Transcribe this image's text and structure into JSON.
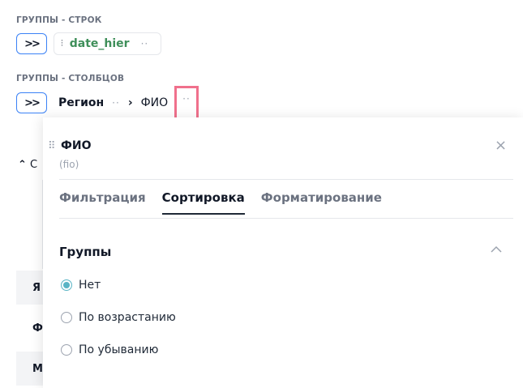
{
  "row_groups": {
    "label": "ГРУППЫ - СТРОК",
    "expand_label": ">>",
    "chip": {
      "hier_icon": "hierarchy-icon",
      "name": "date_hier",
      "dots": "··"
    }
  },
  "col_groups": {
    "label": "ГРУППЫ - СТОЛБЦОВ",
    "expand_label": ">>",
    "region": "Регион",
    "region_dots": "··",
    "separator": "›",
    "fio": "ФИО",
    "fio_dots": "··"
  },
  "background": {
    "collapse_chevron": "^",
    "collapse_letter": "С",
    "rows": [
      "Я",
      "Ф",
      "М"
    ]
  },
  "panel": {
    "drag_icon": "⠿",
    "title": "ФИО",
    "subtitle": "(fio)",
    "close": "×",
    "tabs": [
      {
        "label": "Фильтрация",
        "active": false
      },
      {
        "label": "Сортировка",
        "active": true
      },
      {
        "label": "Форматирование",
        "active": false
      }
    ],
    "group_title": "Группы",
    "group_chevron": "^",
    "options": [
      {
        "label": "Нет",
        "checked": true
      },
      {
        "label": "По возрастанию",
        "checked": false
      },
      {
        "label": "По убыванию",
        "checked": false
      }
    ]
  },
  "colors": {
    "accent": "#3b82f6",
    "highlight": "#f0708c",
    "radio": "#5ab4c5",
    "chip_text": "#3f8f5a"
  }
}
